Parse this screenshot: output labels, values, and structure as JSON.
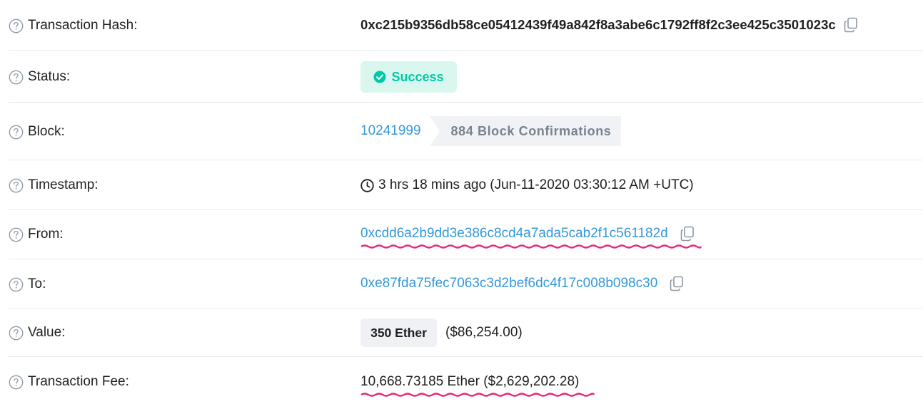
{
  "rows": {
    "hash": {
      "label": "Transaction Hash:",
      "value": "0xc215b9356db58ce05412439f49a842f8a3abe6c1792ff8f2c3ee425c3501023c"
    },
    "status": {
      "label": "Status:",
      "value": "Success"
    },
    "block": {
      "label": "Block:",
      "number": "10241999",
      "confirmations": "884 Block Confirmations"
    },
    "timestamp": {
      "label": "Timestamp:",
      "value": "3 hrs 18 mins ago (Jun-11-2020 03:30:12 AM +UTC)"
    },
    "from": {
      "label": "From:",
      "address": "0xcdd6a2b9dd3e386c8cd4a7ada5cab2f1c561182d"
    },
    "to": {
      "label": "To:",
      "address": "0xe87fda75fec7063c3d2bef6dc4f17c008b098c30"
    },
    "value": {
      "label": "Value:",
      "ether": "350 Ether",
      "usd": "($86,254.00)"
    },
    "fee": {
      "label": "Transaction Fee:",
      "value": "10,668.73185 Ether ($2,629,202.28)"
    }
  },
  "colors": {
    "link": "#3498db",
    "success_text": "#00c9a7",
    "success_bg": "#daf7ef",
    "annotation": "#e8267a"
  },
  "icons": {
    "help": "question-circle-icon",
    "copy": "copy-icon",
    "success": "check-circle-icon",
    "time": "clock-icon"
  }
}
